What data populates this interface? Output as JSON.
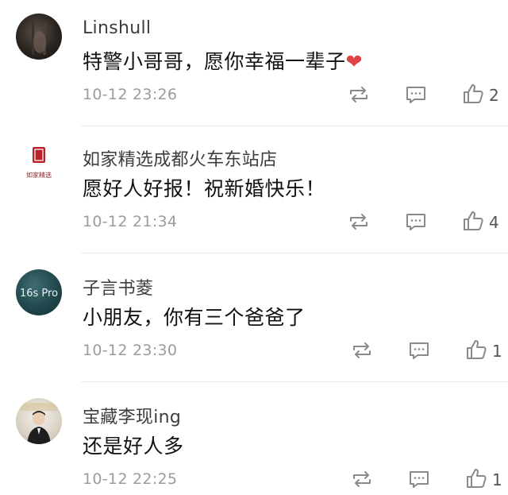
{
  "comments": [
    {
      "user": "Linshull",
      "text": "特警小哥哥，愿你幸福一辈子",
      "emoji": "❤",
      "time": "10-12 23:26",
      "likes": "2"
    },
    {
      "user": "如家精选成都火车东站店",
      "avatar_text": "如家精选",
      "text": "愿好人好报！祝新婚快乐！",
      "time": "10-12 21:34",
      "likes": "4"
    },
    {
      "user": "子言书菱",
      "avatar_text": "16s Pro",
      "text": "小朋友，你有三个爸爸了",
      "time": "10-12 23:30",
      "likes": "1"
    },
    {
      "user": "宝藏李现ing",
      "text": "还是好人多",
      "time": "10-12 22:25",
      "likes": "1"
    }
  ],
  "colors": {
    "username": "#3d3d3d",
    "text": "#111111",
    "time": "#9c9c9c",
    "icon": "#8a8a8a",
    "divider": "#ececec",
    "heart": "#e04343"
  },
  "icons": {
    "repost": "repost-icon",
    "comment": "comment-icon",
    "like": "thumbs-up-icon"
  }
}
